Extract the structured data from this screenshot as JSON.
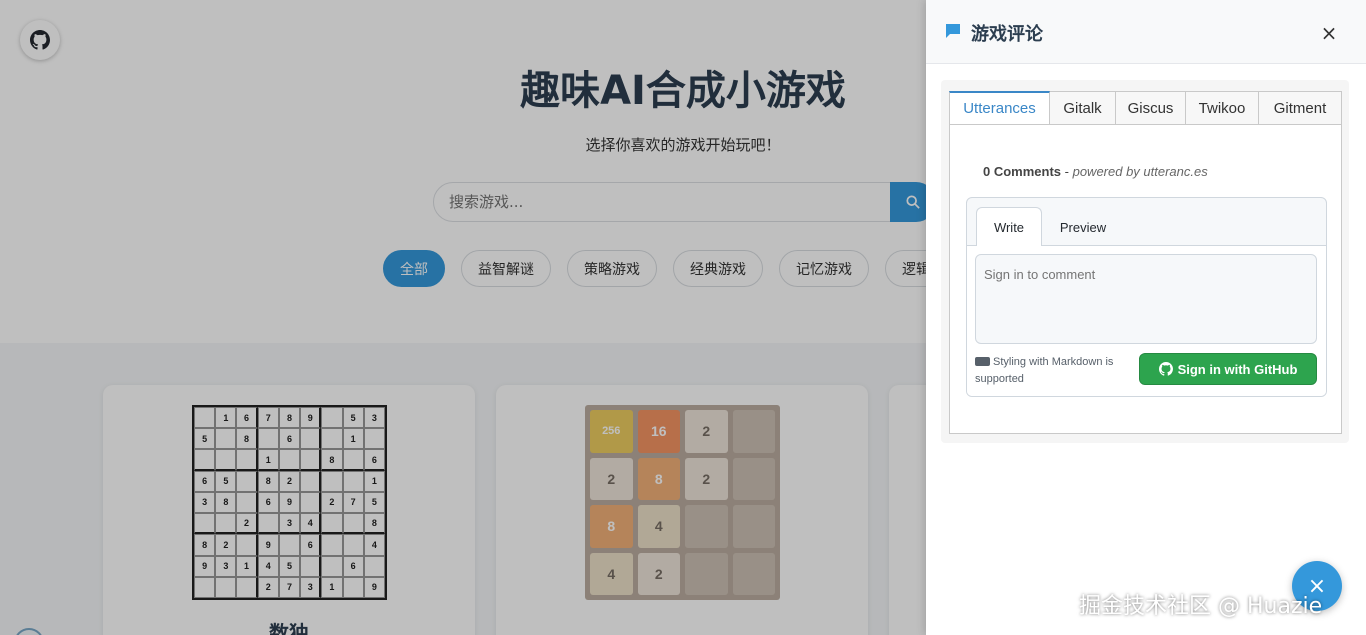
{
  "page": {
    "title": "趣味AI合成小游戏",
    "subtitle": "选择你喜欢的游戏开始玩吧！",
    "search": {
      "placeholder": "搜索游戏..."
    },
    "categories": [
      "全部",
      "益智解谜",
      "策略游戏",
      "经典游戏",
      "记忆游戏",
      "逻辑"
    ],
    "cards": [
      {
        "title": "数独",
        "sudoku": [
          [
            "",
            "1",
            "6",
            "7",
            "8",
            "9",
            "",
            "5",
            "3"
          ],
          [
            "5",
            "",
            "8",
            "",
            "6",
            "",
            "",
            "1",
            ""
          ],
          [
            "",
            "",
            "",
            "1",
            "",
            "",
            "8",
            "",
            "6"
          ],
          [
            "6",
            "5",
            "",
            "8",
            "2",
            "",
            "",
            "",
            "1"
          ],
          [
            "3",
            "8",
            "",
            "6",
            "9",
            "",
            "2",
            "7",
            "5"
          ],
          [
            "",
            "",
            "2",
            "",
            "3",
            "4",
            "",
            "",
            "8"
          ],
          [
            "8",
            "2",
            "",
            "9",
            "",
            "6",
            "",
            "",
            "4"
          ],
          [
            "9",
            "3",
            "1",
            "4",
            "5",
            "",
            "",
            "6",
            ""
          ],
          [
            "",
            "",
            "",
            "2",
            "7",
            "3",
            "1",
            "",
            "9"
          ]
        ]
      },
      {
        "title": "",
        "tiles2048": [
          [
            "256",
            "16",
            "2",
            ""
          ],
          [
            "2",
            "8",
            "2",
            ""
          ],
          [
            "8",
            "4",
            "",
            ""
          ],
          [
            "4",
            "2",
            "",
            ""
          ]
        ]
      }
    ]
  },
  "panel": {
    "title": "游戏评论",
    "close_label": "×",
    "tabs": [
      "Utterances",
      "Gitalk",
      "Giscus",
      "Twikoo",
      "Gitment"
    ],
    "active_tab": "Utterances",
    "utterances": {
      "comment_count": "0 Comments",
      "separator": " - ",
      "powered_by": "powered by utteranc.es",
      "write_tab": "Write",
      "preview_tab": "Preview",
      "textarea_placeholder": "Sign in to comment",
      "markdown_note": "Styling with Markdown is supported",
      "signin_label": "Sign in with GitHub"
    }
  },
  "fab": {
    "label": "×"
  },
  "watermark": "掘金技术社区 @ Huazie",
  "colors": {
    "accent": "#3498db",
    "github_green": "#2da44e",
    "tab_active": "#3a87c7"
  }
}
